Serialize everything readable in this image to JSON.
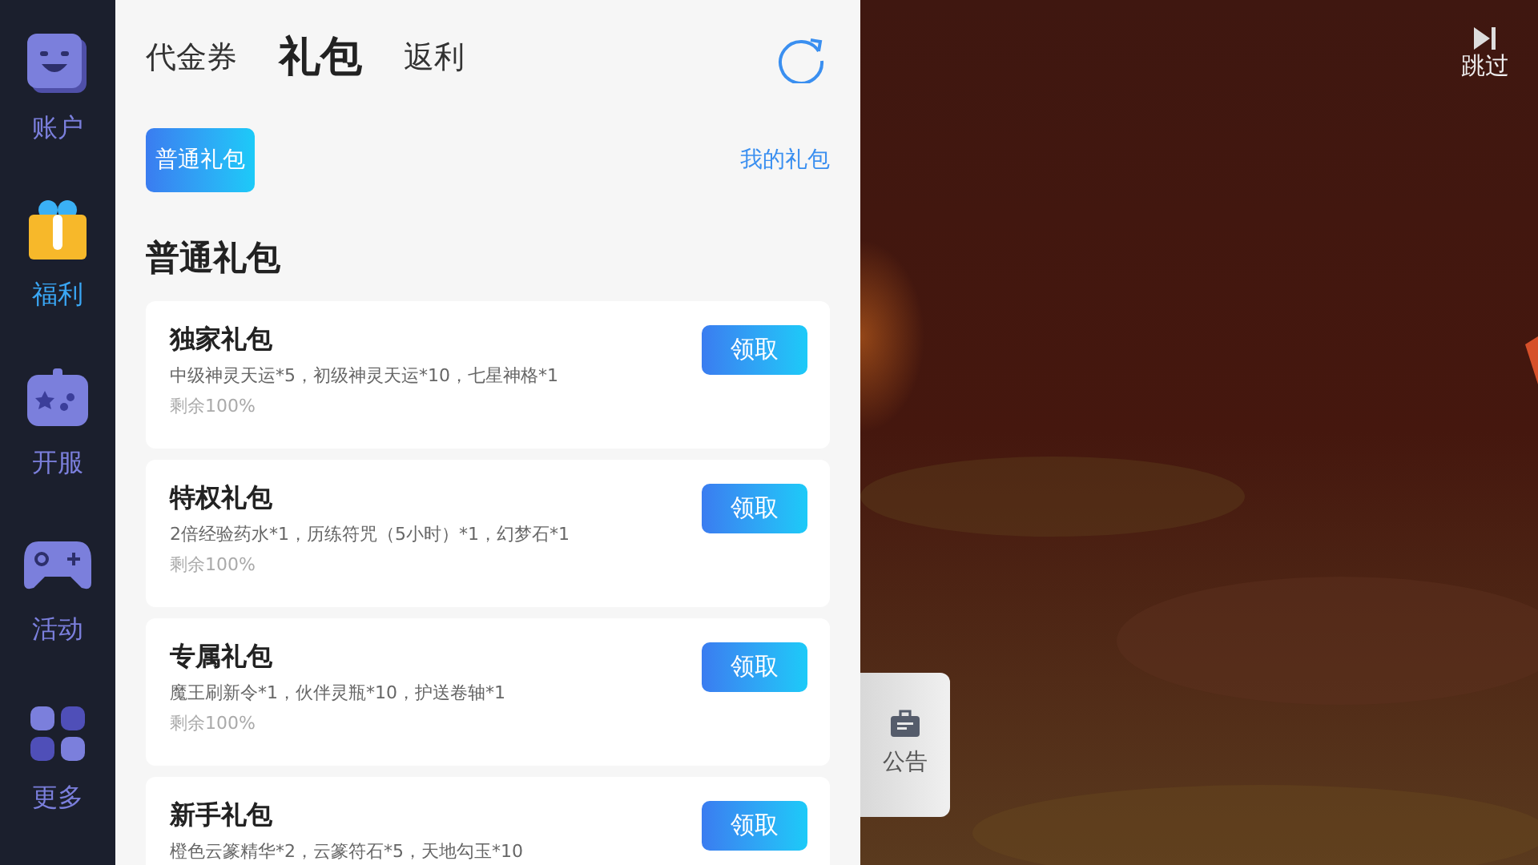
{
  "sidebar": {
    "items": [
      {
        "label": "账户",
        "selected": false
      },
      {
        "label": "福利",
        "selected": true
      },
      {
        "label": "开服",
        "selected": false
      },
      {
        "label": "活动",
        "selected": false
      },
      {
        "label": "更多",
        "selected": false
      }
    ]
  },
  "tabs": [
    {
      "label": "代金券",
      "selected": false
    },
    {
      "label": "礼包",
      "selected": true
    },
    {
      "label": "返利",
      "selected": false
    }
  ],
  "subtabs": [
    {
      "label": "普通礼包",
      "selected": true
    }
  ],
  "my_gifts_link": "我的礼包",
  "section_title": "普通礼包",
  "gifts": [
    {
      "name": "独家礼包",
      "contents": "中级神灵天运*5，初级神灵天运*10，七星神格*1",
      "remaining": "剩余100%",
      "button": "领取"
    },
    {
      "name": "特权礼包",
      "contents": "2倍经验药水*1，历练符咒（5小时）*1，幻梦石*1",
      "remaining": "剩余100%",
      "button": "领取"
    },
    {
      "name": "专属礼包",
      "contents": "魔王刷新令*1，伙伴灵瓶*10，护送卷轴*1",
      "remaining": "剩余100%",
      "button": "领取"
    },
    {
      "name": "新手礼包",
      "contents": "橙色云篆精华*2，云篆符石*5，天地勾玉*10",
      "button": "领取"
    }
  ],
  "skip_button": "跳过",
  "notice_tab": "公告"
}
